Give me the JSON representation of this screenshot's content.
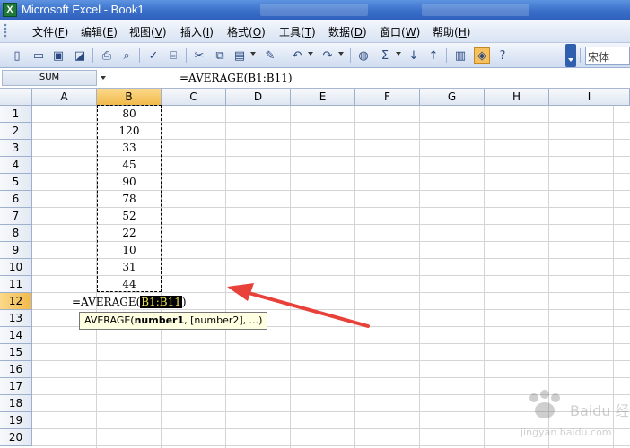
{
  "window": {
    "title": "Microsoft Excel - Book1"
  },
  "menu": [
    {
      "label": "文件",
      "key": "F"
    },
    {
      "label": "编辑",
      "key": "E"
    },
    {
      "label": "视图",
      "key": "V"
    },
    {
      "label": "插入",
      "key": "I"
    },
    {
      "label": "格式",
      "key": "O"
    },
    {
      "label": "工具",
      "key": "T"
    },
    {
      "label": "数据",
      "key": "D"
    },
    {
      "label": "窗口",
      "key": "W"
    },
    {
      "label": "帮助",
      "key": "H"
    }
  ],
  "toolbar": {
    "font_name": "宋体"
  },
  "formula_bar": {
    "name_box": "SUM",
    "formula": "=AVERAGE(B1:B11)"
  },
  "columns": [
    "A",
    "B",
    "C",
    "D",
    "E",
    "F",
    "G",
    "H",
    "I"
  ],
  "rows": [
    "1",
    "2",
    "3",
    "4",
    "5",
    "6",
    "7",
    "8",
    "9",
    "10",
    "11",
    "12",
    "13",
    "14",
    "15",
    "16",
    "17",
    "18",
    "19",
    "20"
  ],
  "column_b_values": [
    "80",
    "120",
    "33",
    "45",
    "90",
    "78",
    "52",
    "22",
    "10",
    "31",
    "44"
  ],
  "active_cell": {
    "prefix": "=AVERAGE(",
    "range": "B1:B11",
    "suffix": ")"
  },
  "tooltip": {
    "func": "AVERAGE(",
    "arg1": "number1",
    "rest": ", [number2], ...)"
  },
  "watermark": {
    "text": "Baidu 经验",
    "url": "jingyan.baidu.com"
  },
  "colors": {
    "selection_header": "#f1b94a",
    "title_bar": "#3a6fc9",
    "annotation_arrow": "#e8413a"
  }
}
